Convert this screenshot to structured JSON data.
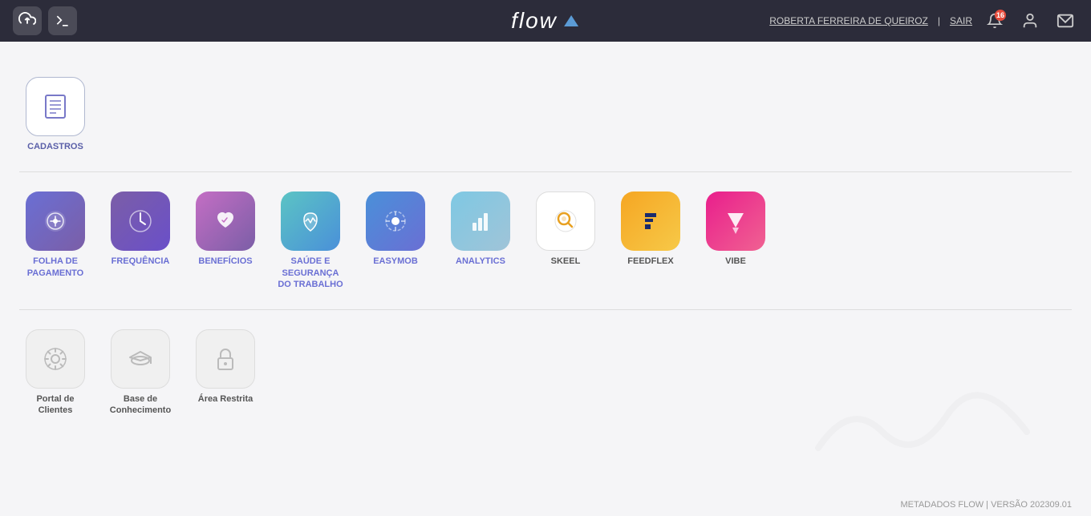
{
  "header": {
    "logo_text": "flow",
    "user_name": "ROBERTA FERREIRA DE QUEIROZ",
    "separator": "|",
    "logout_label": "SAIR",
    "notification_count": "16"
  },
  "sections": [
    {
      "id": "cadastros",
      "apps": [
        {
          "id": "cadastros",
          "label": "CADASTROS",
          "icon_type": "cadastros",
          "color": "cadastros-icon"
        }
      ]
    },
    {
      "id": "main-apps",
      "apps": [
        {
          "id": "folha",
          "label": "FOLHA DE PAGAMENTO",
          "icon_type": "folha",
          "color": "icon-blue-purple"
        },
        {
          "id": "frequencia",
          "label": "FREQUÊNCIA",
          "icon_type": "frequencia",
          "color": "icon-purple"
        },
        {
          "id": "beneficios",
          "label": "BENEFÍCIOS",
          "icon_type": "beneficios",
          "color": "icon-pink-purple"
        },
        {
          "id": "saude",
          "label": "SAÚDE E SEGURANÇA DO TRABALHO",
          "icon_type": "saude",
          "color": "icon-teal-blue"
        },
        {
          "id": "easymob",
          "label": "EASYMOB",
          "icon_type": "easymob",
          "color": "icon-blue-dash"
        },
        {
          "id": "analytics",
          "label": "ANALYTICS",
          "icon_type": "analytics",
          "color": "icon-light-blue"
        },
        {
          "id": "skeel",
          "label": "SKEEL",
          "icon_type": "skeel",
          "color": "icon-white-gray"
        },
        {
          "id": "feedflex",
          "label": "FEEDFLEX",
          "icon_type": "feedflex",
          "color": "icon-orange-yellow"
        },
        {
          "id": "vibe",
          "label": "VIBE",
          "icon_type": "vibe",
          "color": "icon-pink-magenta"
        }
      ]
    },
    {
      "id": "portal-apps",
      "apps": [
        {
          "id": "portal",
          "label": "Portal de Clientes",
          "icon_type": "portal",
          "color": "icon-gray"
        },
        {
          "id": "base",
          "label": "Base de Conhecimento",
          "icon_type": "base",
          "color": "icon-gray"
        },
        {
          "id": "restrita",
          "label": "Área Restrita",
          "icon_type": "restrita",
          "color": "icon-gray"
        }
      ]
    }
  ],
  "footer": {
    "text": "METADADOS FLOW | VERSÃO 202309.01"
  }
}
